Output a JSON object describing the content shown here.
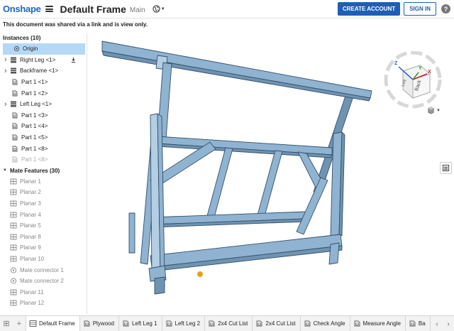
{
  "header": {
    "logo": "Onshape",
    "doc_title": "Default Frame",
    "branch": "Main",
    "create_account": "CREATE ACCOUNT",
    "sign_in": "SIGN IN",
    "help": "?"
  },
  "notice": "This document was shared via a link and is view only.",
  "instances": {
    "title": "Instances (10)",
    "items": [
      {
        "label": "Origin",
        "kind": "origin",
        "selected": true
      },
      {
        "label": "Right Leg <1>",
        "kind": "assembly",
        "expandable": true
      },
      {
        "label": "Backframe <1>",
        "kind": "assembly",
        "expandable": true
      },
      {
        "label": "Part 1 <1>",
        "kind": "part"
      },
      {
        "label": "Part 1 <2>",
        "kind": "part"
      },
      {
        "label": "Left Leg <1>",
        "kind": "assembly",
        "expandable": true
      },
      {
        "label": "Part 1 <3>",
        "kind": "part"
      },
      {
        "label": "Part 1 <4>",
        "kind": "part"
      },
      {
        "label": "Part 1 <5>",
        "kind": "part"
      },
      {
        "label": "Part 1 <8>",
        "kind": "part"
      },
      {
        "label": "Part 1 <8>",
        "kind": "part",
        "dim": true
      }
    ]
  },
  "mates": {
    "title": "Mate Features (30)",
    "items": [
      {
        "label": "Planar 1",
        "kind": "mate"
      },
      {
        "label": "Planar 2",
        "kind": "mate"
      },
      {
        "label": "Planar 3",
        "kind": "mate"
      },
      {
        "label": "Planar 4",
        "kind": "mate"
      },
      {
        "label": "Planar 5",
        "kind": "mate"
      },
      {
        "label": "Planar 8",
        "kind": "mate"
      },
      {
        "label": "Planar 9",
        "kind": "mate"
      },
      {
        "label": "Planar 10",
        "kind": "mate"
      },
      {
        "label": "Mate connector 1",
        "kind": "connector"
      },
      {
        "label": "Mate connector 2",
        "kind": "connector"
      },
      {
        "label": "Planar 11",
        "kind": "mate"
      },
      {
        "label": "Planar 12",
        "kind": "mate"
      }
    ]
  },
  "view_cube": {
    "front_label": "Back",
    "side_label": "Left",
    "axis_x": "X",
    "axis_y": "Y",
    "axis_z": "Z"
  },
  "colors": {
    "brand": "#1f66c2",
    "selection": "#b6d8f7",
    "model_fill": "#8fb3d0",
    "model_edge": "#33506a",
    "origin_dot": "#e8a020"
  },
  "tabs": [
    {
      "label": "Default Frame",
      "kind": "assembly",
      "active": true
    },
    {
      "label": "Plywood",
      "kind": "part"
    },
    {
      "label": "Left Leg 1",
      "kind": "part"
    },
    {
      "label": "Left Leg 2",
      "kind": "part"
    },
    {
      "label": "2x4 Cut List",
      "kind": "part"
    },
    {
      "label": "2x4 Cut List",
      "kind": "part"
    },
    {
      "label": "Check Angle",
      "kind": "part"
    },
    {
      "label": "Measure Angle",
      "kind": "part"
    },
    {
      "label": "Ba",
      "kind": "part"
    }
  ]
}
